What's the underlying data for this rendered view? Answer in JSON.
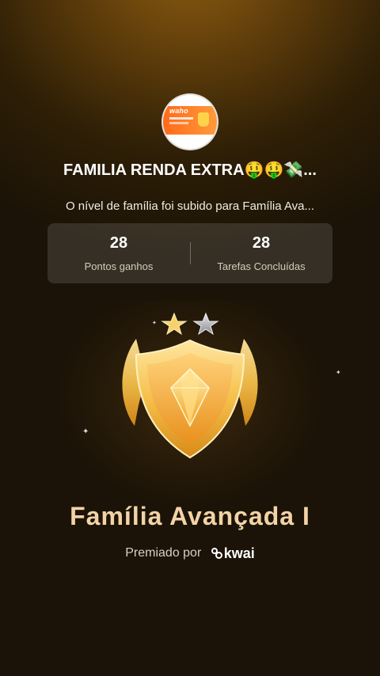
{
  "group": {
    "name": "FAMILIA RENDA EXTRA🤑🤑💸...",
    "avatar_text": "waho"
  },
  "message": "O nível de família foi subido para Família Ava...",
  "stats": [
    {
      "value": "28",
      "label": "Pontos ganhos"
    },
    {
      "value": "28",
      "label": "Tarefas Concluídas"
    }
  ],
  "badge": {
    "icon": "shield-diamond-badge-icon",
    "stars": [
      "gold-star-icon",
      "silver-star-icon"
    ]
  },
  "level_title": "Família Avançada I",
  "awarded_by": {
    "prefix": "Premiado por",
    "brand": "kwai"
  },
  "colors": {
    "background": "#2e1f06",
    "accent_gold": "#f5c04a",
    "title": "#f3d3a6"
  }
}
